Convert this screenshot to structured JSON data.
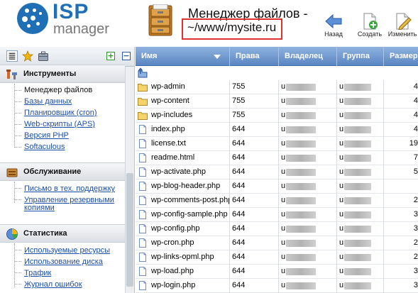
{
  "brand": {
    "name": "ISP",
    "product": "manager"
  },
  "header": {
    "title": "Менеджер файлов -",
    "path": "~/www/mysite.ru"
  },
  "toolbar": {
    "back_label": "Назад",
    "create_label": "Создать",
    "edit_label": "Изменить"
  },
  "sidebar": {
    "sections": [
      {
        "title": "Инструменты",
        "icon": "tools-icon",
        "items": [
          {
            "label": "Менеджер файлов",
            "active": true
          },
          {
            "label": "Базы данных"
          },
          {
            "label": "Планировщик (cron)"
          },
          {
            "label": "Web-скрипты (APS)"
          },
          {
            "label": "Версия PHP"
          },
          {
            "label": "Softaculous"
          }
        ]
      },
      {
        "title": "Обслуживание",
        "icon": "maintenance-icon",
        "items": [
          {
            "label": "Письмо в тех. поддержку"
          },
          {
            "label": "Управление резервными копиями"
          }
        ]
      },
      {
        "title": "Статистика",
        "icon": "statistics-icon",
        "items": [
          {
            "label": "Используемые ресурсы"
          },
          {
            "label": "Использование диска"
          },
          {
            "label": "Трафик"
          },
          {
            "label": "Журнал ошибок"
          }
        ]
      }
    ]
  },
  "table": {
    "columns": [
      "Имя",
      "Права",
      "Владелец",
      "Группа",
      "Размер"
    ],
    "rows": [
      {
        "name": "wp-admin",
        "type": "folder",
        "perm": "755",
        "owner": "u",
        "group": "u",
        "size": "4"
      },
      {
        "name": "wp-content",
        "type": "folder",
        "perm": "755",
        "owner": "u",
        "group": "u",
        "size": "4"
      },
      {
        "name": "wp-includes",
        "type": "folder",
        "perm": "755",
        "owner": "u",
        "group": "u",
        "size": "4"
      },
      {
        "name": "index.php",
        "type": "file",
        "perm": "644",
        "owner": "u",
        "group": "u",
        "size": "4"
      },
      {
        "name": "license.txt",
        "type": "file",
        "perm": "644",
        "owner": "u",
        "group": "u",
        "size": "19"
      },
      {
        "name": "readme.html",
        "type": "file",
        "perm": "644",
        "owner": "u",
        "group": "u",
        "size": "7"
      },
      {
        "name": "wp-activate.php",
        "type": "file",
        "perm": "644",
        "owner": "u",
        "group": "u",
        "size": "5"
      },
      {
        "name": "wp-blog-header.php",
        "type": "file",
        "perm": "644",
        "owner": "u",
        "group": "u",
        "size": ""
      },
      {
        "name": "wp-comments-post.php",
        "type": "file",
        "perm": "644",
        "owner": "u",
        "group": "u",
        "size": "2"
      },
      {
        "name": "wp-config-sample.php",
        "type": "file",
        "perm": "644",
        "owner": "u",
        "group": "u",
        "size": "3"
      },
      {
        "name": "wp-config.php",
        "type": "file",
        "perm": "644",
        "owner": "u",
        "group": "u",
        "size": "3"
      },
      {
        "name": "wp-cron.php",
        "type": "file",
        "perm": "644",
        "owner": "u",
        "group": "u",
        "size": "2"
      },
      {
        "name": "wp-links-opml.php",
        "type": "file",
        "perm": "644",
        "owner": "u",
        "group": "u",
        "size": "2"
      },
      {
        "name": "wp-load.php",
        "type": "file",
        "perm": "644",
        "owner": "u",
        "group": "u",
        "size": "3"
      },
      {
        "name": "wp-login.php",
        "type": "file",
        "perm": "644",
        "owner": "u",
        "group": "u",
        "size": "3"
      }
    ]
  },
  "colors": {
    "brand": "#1e6fb5",
    "header_bar": "#5b86c2",
    "link": "#1c4fa8",
    "highlight": "#e03030"
  }
}
